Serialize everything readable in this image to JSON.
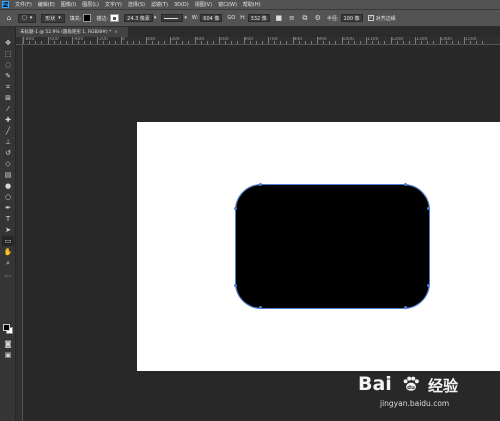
{
  "app": {
    "logo": "Ps"
  },
  "menu": [
    "文件(F)",
    "编辑(E)",
    "图像(I)",
    "图层(L)",
    "文字(Y)",
    "选择(S)",
    "滤镜(T)",
    "3D(D)",
    "视图(V)",
    "窗口(W)",
    "帮助(H)"
  ],
  "options": {
    "mode": "形状",
    "fill_label": "填充:",
    "stroke_label": "描边:",
    "stroke_width": "24.3 像素",
    "w_label": "W:",
    "w_value": "604 像",
    "link": "GO",
    "h_label": "H:",
    "h_value": "332 像",
    "radius_label": "半径:",
    "radius_value": "100 像",
    "align_edges": "对齐边缘",
    "fill_color": "#000000",
    "stroke_color": "#ffffff"
  },
  "document_tab": {
    "title": "未标题-1 @ 52.9% (圆角矩形 1, RGB/8#) *",
    "close": "×"
  },
  "ruler": {
    "labels": [
      "-800",
      "-600",
      "-400",
      "-200",
      "0",
      "200",
      "300",
      "400",
      "500",
      "600",
      "700",
      "800",
      "900",
      "1000",
      "1100",
      "1200",
      "1300",
      "1400",
      "1500"
    ]
  },
  "canvas": {
    "background": "#ffffff",
    "shape_color": "#000000",
    "selection_color": "#4a7fd6"
  },
  "watermark": {
    "brand_a": "Bai",
    "brand_b": "经验",
    "url": "jingyan.baidu.com"
  }
}
